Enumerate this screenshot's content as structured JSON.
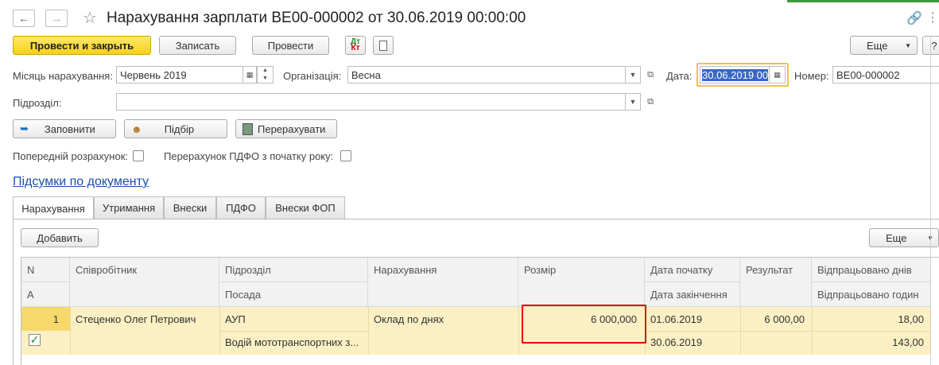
{
  "title": "Нарахування зарплати ВЕ00-000002 от 30.06.2019 00:00:00",
  "toolbar": {
    "post_close": "Провести и закрыть",
    "save": "Записать",
    "post": "Провести",
    "dt_kt": "Дт Кт",
    "more": "Еще",
    "help": "?"
  },
  "fields": {
    "month_label": "Місяць нарахування:",
    "month_value": "Червень 2019",
    "org_label": "Організація:",
    "org_value": "Весна",
    "date_label": "Дата:",
    "date_value": "30.06.2019 00",
    "number_label": "Номер:",
    "number_value": "ВЕ00-000002",
    "dept_label": "Підрозділ:",
    "dept_value": ""
  },
  "actions": {
    "fill": "Заповнити",
    "select": "Підбір",
    "recalc": "Перерахувати"
  },
  "checks": {
    "prelim_label": "Попередній розрахунок:",
    "prelim_checked": false,
    "pdfo_label": "Перерахунок ПДФО з початку року:",
    "pdfo_checked": false
  },
  "summary_link": "Підсумки по документу",
  "tabs": [
    "Нарахування",
    "Утримання",
    "Внески",
    "ПДФО",
    "Внески ФОП"
  ],
  "active_tab": 0,
  "table_toolbar": {
    "add": "Добавить",
    "more": "Еще"
  },
  "table": {
    "headers": {
      "n": "N",
      "a": "А",
      "employee": "Співробітник",
      "dept": "Підрозділ",
      "position": "Посада",
      "accrual": "Нарахування",
      "size": "Розмір",
      "start": "Дата початку",
      "end": "Дата закінчення",
      "result": "Результат",
      "days": "Відпрацьовано днів",
      "hours": "Відпрацьовано годин"
    },
    "rows": [
      {
        "n": "1",
        "checked": true,
        "employee": "Стеценко Олег Петрович",
        "dept": "АУП",
        "position": "Водій мототранспортних з...",
        "accrual": "Оклад по днях",
        "size": "6 000,000",
        "start": "01.06.2019",
        "end": "30.06.2019",
        "result": "6 000,00",
        "days": "18,00",
        "hours": "143,00"
      }
    ]
  }
}
